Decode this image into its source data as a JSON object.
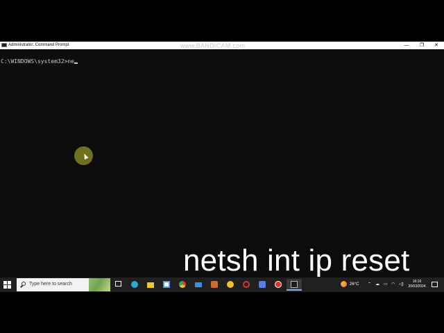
{
  "window": {
    "title": "Administrator: Command Prompt",
    "watermark": "www.BANDICAM.com",
    "minimize_glyph": "—",
    "maximize_glyph": "❐",
    "close_glyph": "✕"
  },
  "console": {
    "prompt": "C:\\WINDOWS\\system32>",
    "typed_text": "ne"
  },
  "caption": {
    "text": "netsh int ip reset"
  },
  "taskbar": {
    "search_placeholder": "Type here to search",
    "pinned_apps": [
      {
        "name": "task-view",
        "color": "#ffffff"
      },
      {
        "name": "edge",
        "color": "#2fa6d9"
      },
      {
        "name": "file-explorer",
        "color": "#f3c533"
      },
      {
        "name": "microsoft-store",
        "color": "#4c9be8"
      },
      {
        "name": "chrome",
        "color": "#e8b53a"
      },
      {
        "name": "mail",
        "color": "#3c8fe0"
      },
      {
        "name": "app-orange",
        "color": "#d06b2b"
      },
      {
        "name": "app-star",
        "color": "#f0c030"
      },
      {
        "name": "opera",
        "color": "#e0303a"
      },
      {
        "name": "app-blue",
        "color": "#5a7be8"
      },
      {
        "name": "bandicam-record",
        "color": "#e03030"
      },
      {
        "name": "command-prompt",
        "color": "#1a1a1a"
      }
    ],
    "weather": "26°C",
    "clock_time": "16:16",
    "clock_date": "20/03/2024"
  }
}
